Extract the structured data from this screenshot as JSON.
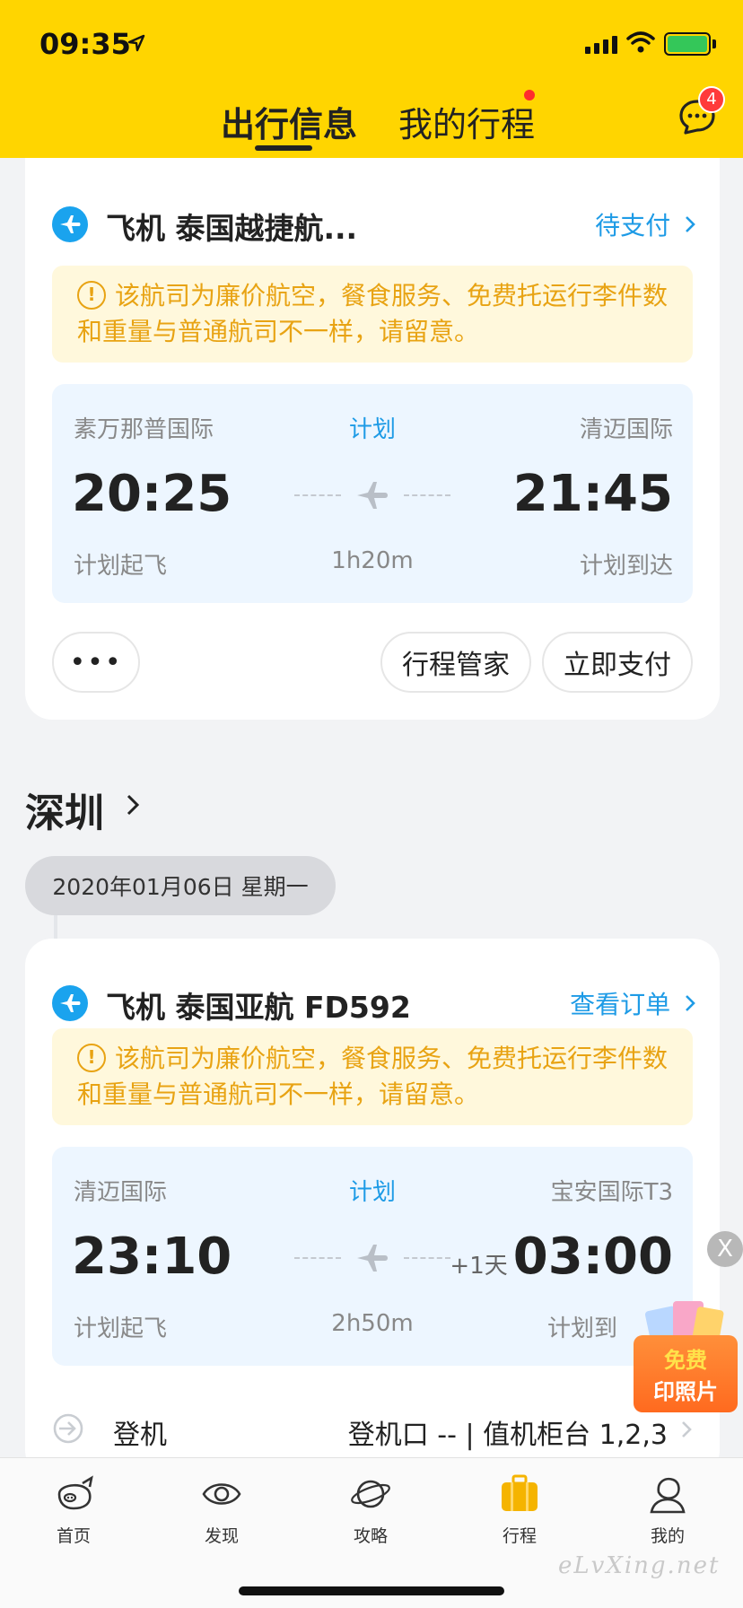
{
  "status_bar": {
    "time": "09:35"
  },
  "header": {
    "tabs": [
      {
        "label": "出行信息",
        "active": true
      },
      {
        "label": "我的行程",
        "active": false,
        "has_dot": true
      }
    ],
    "message_badge": "4"
  },
  "colors": {
    "accent": "#ffd500",
    "link": "#1e9be6",
    "warning": "#e8a313",
    "badge": "#ff3b3b"
  },
  "trips": [
    {
      "title": "飞机 泰国越捷航...",
      "action": "待支付",
      "notice": "该航司为廉价航空，餐食服务、免费托运行李件数和重量与普通航司不一样，请留意。",
      "from_airport": "素万那普国际",
      "status": "计划",
      "to_airport": "清迈国际",
      "dep_time": "20:25",
      "arr_time": "21:45",
      "day_offset": "",
      "dep_label": "计划起飞",
      "duration": "1h20m",
      "arr_label": "计划到达",
      "buttons": {
        "more": "•••",
        "assistant": "行程管家",
        "pay": "立即支付"
      }
    },
    {
      "title": "飞机 泰国亚航 FD592",
      "action": "查看订单",
      "notice": "该航司为廉价航空，餐食服务、免费托运行李件数和重量与普通航司不一样，请留意。",
      "from_airport": "清迈国际",
      "status": "计划",
      "to_airport": "宝安国际T3",
      "dep_time": "23:10",
      "arr_time": "03:00",
      "day_offset": "+1天",
      "dep_label": "计划起飞",
      "duration": "2h50m",
      "arr_label": "计划到",
      "boarding": {
        "label": "登机",
        "info": "登机口 -- | 值机柜台 1,2,3"
      }
    }
  ],
  "section": {
    "city": "深圳",
    "date": "2020年01月06日 星期一"
  },
  "promo": {
    "line1": "免费",
    "line2": "印照片",
    "close": "X"
  },
  "tabbar": [
    {
      "label": "首页",
      "icon": "pig-icon"
    },
    {
      "label": "发现",
      "icon": "eye-icon"
    },
    {
      "label": "攻略",
      "icon": "planet-icon"
    },
    {
      "label": "行程",
      "icon": "suitcase-icon",
      "active": true
    },
    {
      "label": "我的",
      "icon": "user-icon"
    }
  ],
  "watermark": "eLvXing.net"
}
